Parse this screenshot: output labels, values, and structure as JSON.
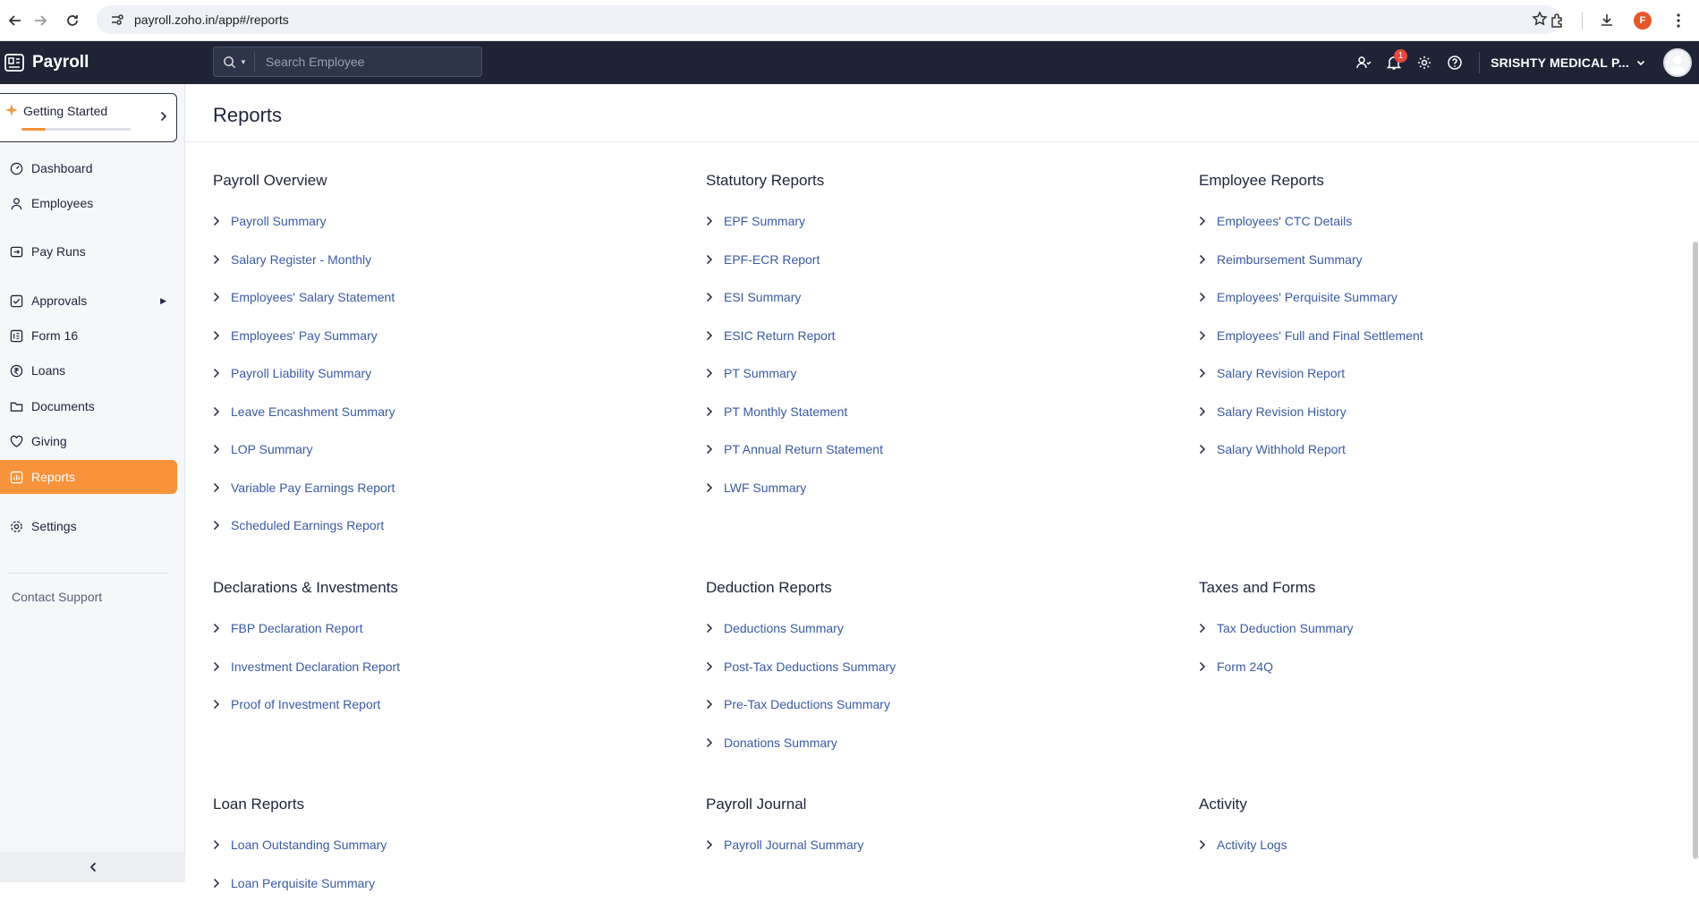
{
  "browser": {
    "url": "payroll.zoho.in/app#/reports",
    "profile_initial": "F"
  },
  "app": {
    "name": "Payroll",
    "search_placeholder": "Search Employee",
    "notification_count": "1",
    "org_name": "SRISHTY MEDICAL P..."
  },
  "sidebar": {
    "getting_started": {
      "label": "Getting Started",
      "progress": 0.22
    },
    "items": [
      {
        "label": "Dashboard",
        "icon": "dashboard-icon"
      },
      {
        "label": "Employees",
        "icon": "user-icon"
      },
      {
        "label": "Pay Runs",
        "icon": "payrun-icon"
      },
      {
        "label": "Approvals",
        "icon": "check-square-icon"
      },
      {
        "label": "Form 16",
        "icon": "form-icon"
      },
      {
        "label": "Loans",
        "icon": "rupee-icon"
      },
      {
        "label": "Documents",
        "icon": "folder-icon"
      },
      {
        "label": "Giving",
        "icon": "heart-icon"
      },
      {
        "label": "Reports",
        "icon": "reports-icon"
      },
      {
        "label": "Settings",
        "icon": "gear-icon"
      }
    ],
    "contact_support": "Contact Support"
  },
  "main": {
    "title": "Reports",
    "sections": [
      {
        "title": "Payroll Overview",
        "links": [
          "Payroll Summary",
          "Salary Register - Monthly",
          "Employees' Salary Statement",
          "Employees' Pay Summary",
          "Payroll Liability Summary",
          "Leave Encashment Summary",
          "LOP Summary",
          "Variable Pay Earnings Report",
          "Scheduled Earnings Report"
        ]
      },
      {
        "title": "Statutory Reports",
        "links": [
          "EPF Summary",
          "EPF-ECR Report",
          "ESI Summary",
          "ESIC Return Report",
          "PT Summary",
          "PT Monthly Statement",
          "PT Annual Return Statement",
          "LWF Summary"
        ]
      },
      {
        "title": "Employee Reports",
        "links": [
          "Employees' CTC Details",
          "Reimbursement Summary",
          "Employees' Perquisite Summary",
          "Employees' Full and Final Settlement",
          "Salary Revision Report",
          "Salary Revision History",
          "Salary Withhold Report"
        ]
      },
      {
        "title": "Declarations & Investments",
        "links": [
          "FBP Declaration Report",
          "Investment Declaration Report",
          "Proof of Investment Report"
        ]
      },
      {
        "title": "Deduction Reports",
        "links": [
          "Deductions Summary",
          "Post-Tax Deductions Summary",
          "Pre-Tax Deductions Summary",
          "Donations Summary"
        ]
      },
      {
        "title": "Taxes and Forms",
        "links": [
          "Tax Deduction Summary",
          "Form 24Q"
        ]
      },
      {
        "title": "Loan Reports",
        "links": [
          "Loan Outstanding Summary",
          "Loan Perquisite Summary"
        ]
      },
      {
        "title": "Payroll Journal",
        "links": [
          "Payroll Journal Summary"
        ]
      },
      {
        "title": "Activity",
        "links": [
          "Activity Logs"
        ]
      }
    ]
  }
}
